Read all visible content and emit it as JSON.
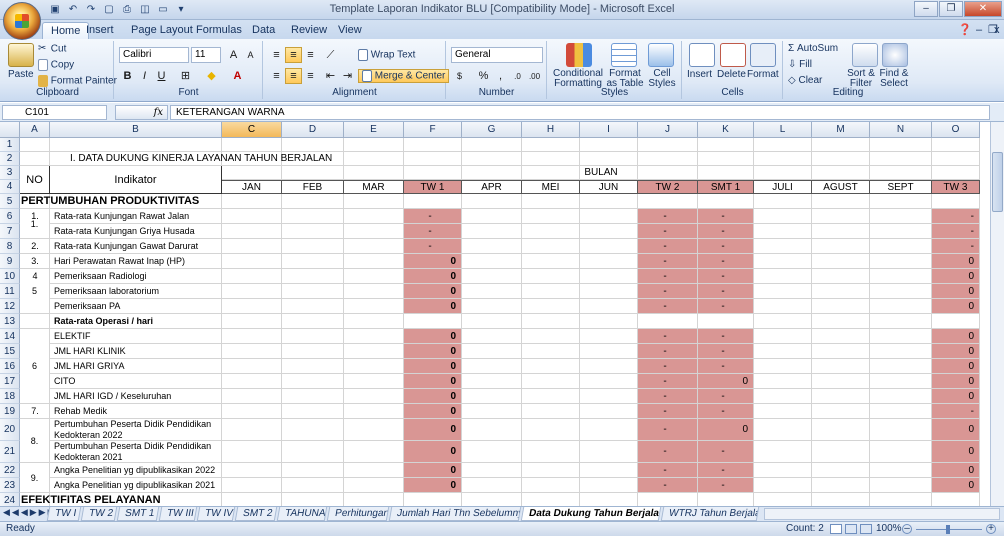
{
  "window": {
    "title": "Template Laporan Indikator BLU  [Compatibility Mode] - Microsoft Excel"
  },
  "ribbon_tabs": [
    "Home",
    "Insert",
    "Page Layout",
    "Formulas",
    "Data",
    "Review",
    "View"
  ],
  "clipboard": {
    "paste": "Paste",
    "cut": "Cut",
    "copy": "Copy",
    "painter": "Format Painter",
    "label": "Clipboard"
  },
  "font": {
    "name": "Calibri",
    "size": "11",
    "label": "Font"
  },
  "alignment": {
    "wrap": "Wrap Text",
    "merge": "Merge & Center",
    "label": "Alignment"
  },
  "number": {
    "format": "General",
    "label": "Number"
  },
  "styles": {
    "conditional": "Conditional Formatting",
    "format_table": "Format as Table",
    "cell_styles": "Cell Styles",
    "label": "Styles"
  },
  "cells": {
    "insert": "Insert",
    "delete": "Delete",
    "format": "Format",
    "label": "Cells"
  },
  "editing": {
    "autosum": "AutoSum",
    "fill": "Fill",
    "clear": "Clear",
    "sort": "Sort & Filter",
    "find": "Find & Select",
    "label": "Editing"
  },
  "formula_bar": {
    "namebox": "C101",
    "fx": "fx",
    "content": "KETERANGAN WARNA"
  },
  "columns": [
    "A",
    "B",
    "C",
    "D",
    "E",
    "F",
    "G",
    "H",
    "I",
    "J",
    "K",
    "L",
    "M",
    "N",
    "O"
  ],
  "sheet": {
    "title": "I. DATA DUKUNG KINERJA LAYANAN TAHUN BERJALAN",
    "no_header": "NO",
    "indikator_header": "Indikator",
    "bulan_header": "BULAN",
    "months": [
      "JAN",
      "FEB",
      "MAR",
      "TW 1",
      "APR",
      "MEI",
      "JUN",
      "TW 2",
      "SMT 1",
      "JULI",
      "AGUST",
      "SEPT",
      "TW 3"
    ],
    "section1": "PERTUMBUHAN PRODUKTIVITAS",
    "section2": "EFEKTIFITAS PELAYANAN",
    "rows": [
      {
        "r": "6",
        "no": "1.",
        "ind": "Rata-rata Kunjungan Rawat Jalan",
        "f": "-",
        "j": "-",
        "k": "-",
        "o": "-"
      },
      {
        "r": "7",
        "no": "",
        "ind": "Rata-rata Kunjungan Griya Husada",
        "f": "-",
        "j": "-",
        "k": "-",
        "o": "-"
      },
      {
        "r": "8",
        "no": "2.",
        "ind": "Rata-rata Kunjungan Gawat Darurat",
        "f": "-",
        "j": "-",
        "k": "-",
        "o": "-"
      },
      {
        "r": "9",
        "no": "3.",
        "ind": "Hari Perawatan Rawat Inap (HP)",
        "f": "0",
        "j": "-",
        "k": "-",
        "o": "0"
      },
      {
        "r": "10",
        "no": "4",
        "ind": "Pemeriksaan Radiologi",
        "f": "0",
        "j": "-",
        "k": "-",
        "o": "0"
      },
      {
        "r": "11",
        "no": "",
        "ind": "Pemeriksaan laboratorium",
        "f": "0",
        "j": "-",
        "k": "-",
        "o": "0"
      },
      {
        "r": "12",
        "no": "",
        "ind": "Pemeriksaan PA",
        "f": "0",
        "j": "-",
        "k": "-",
        "o": "0"
      },
      {
        "r": "13",
        "no": "",
        "ind": "Rata-rata Operasi / hari",
        "f": "",
        "j": "",
        "k": "",
        "o": ""
      },
      {
        "r": "14",
        "no": "",
        "ind": "ELEKTIF",
        "f": "0",
        "j": "-",
        "k": "-",
        "o": "0"
      },
      {
        "r": "15",
        "no": "",
        "ind": "JML HARI KLINIK",
        "f": "0",
        "j": "-",
        "k": "-",
        "o": "0"
      },
      {
        "r": "16",
        "no": "",
        "ind": "JML HARI GRIYA",
        "f": "0",
        "j": "-",
        "k": "-",
        "o": "0"
      },
      {
        "r": "17",
        "no": "",
        "ind": "CITO",
        "f": "0",
        "j": "-",
        "k": "0",
        "o": "0"
      },
      {
        "r": "18",
        "no": "",
        "ind": "JML HARI IGD / Keseluruhan",
        "f": "0",
        "j": "-",
        "k": "-",
        "o": "0"
      },
      {
        "r": "19",
        "no": "7.",
        "ind": "Rehab Medik",
        "f": "0",
        "j": "-",
        "k": "-",
        "o": "-"
      },
      {
        "r": "20",
        "no": "",
        "ind": "Pertumbuhan Peserta Didik Pendidikan Kedokteran 2022",
        "f": "0",
        "j": "-",
        "k": "0",
        "o": "0"
      },
      {
        "r": "21",
        "no": "",
        "ind": "Pertumbuhan Peserta Didik Pendidikan Kedokteran 2021",
        "f": "0",
        "j": "-",
        "k": "-",
        "o": "0"
      },
      {
        "r": "22",
        "no": "",
        "ind": "Angka Penelitian yg dipublikasikan 2022",
        "f": "0",
        "j": "-",
        "k": "-",
        "o": "0"
      },
      {
        "r": "23",
        "no": "",
        "ind": "Angka Penelitian yg dipublikasikan 2021",
        "f": "0",
        "j": "-",
        "k": "-",
        "o": "0"
      }
    ],
    "merged_no": {
      "r6_7": "1.",
      "r10_12": "5",
      "r14_18": "6",
      "r20_21": "8.",
      "r22_23": "9."
    }
  },
  "sheet_tabs": [
    "TW I",
    "TW 2",
    "SMT 1",
    "TW III",
    "TW IV",
    "SMT 2",
    "TAHUNAN",
    "Perhitungan",
    "Jumlah Hari Thn Sebelumnya",
    "Data Dukung Tahun Berjalan",
    "WTRJ Tahun Berjalan"
  ],
  "status": {
    "ready": "Ready",
    "count": "Count: 2",
    "zoom": "100%"
  },
  "colors": {
    "pink": "#d99694",
    "selected_col": "#f4b84e"
  }
}
